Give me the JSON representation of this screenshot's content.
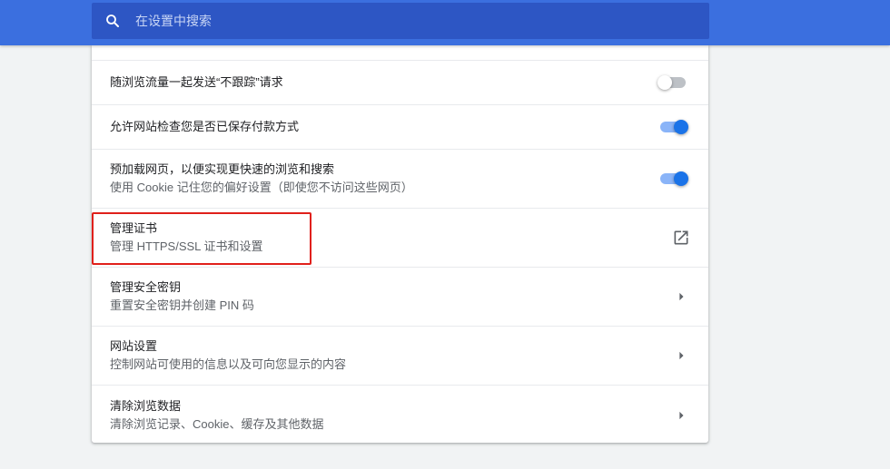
{
  "search": {
    "placeholder": "在设置中搜索",
    "value": ""
  },
  "colors": {
    "header": "#3b6fdf",
    "search_box": "#2d56c4",
    "toggle_on": "#1a73e8",
    "highlight": "#e0201b"
  },
  "settings": [
    {
      "title": "随浏览流量一起发送“不跟踪”请求",
      "subtitle": "",
      "control": "toggle",
      "state": "off"
    },
    {
      "title": "允许网站检查您是否已保存付款方式",
      "subtitle": "",
      "control": "toggle",
      "state": "on"
    },
    {
      "title": "预加载网页，以便实现更快速的浏览和搜索",
      "subtitle": "使用 Cookie 记住您的偏好设置（即使您不访问这些网页）",
      "control": "toggle",
      "state": "on"
    },
    {
      "title": "管理证书",
      "subtitle": "管理 HTTPS/SSL 证书和设置",
      "control": "external-link-icon"
    },
    {
      "title": "管理安全密钥",
      "subtitle": "重置安全密钥并创建 PIN 码",
      "control": "chevron-right-icon"
    },
    {
      "title": "网站设置",
      "subtitle": "控制网站可使用的信息以及可向您显示的内容",
      "control": "chevron-right-icon"
    },
    {
      "title": "清除浏览数据",
      "subtitle": "清除浏览记录、Cookie、缓存及其他数据",
      "control": "chevron-right-icon"
    }
  ]
}
